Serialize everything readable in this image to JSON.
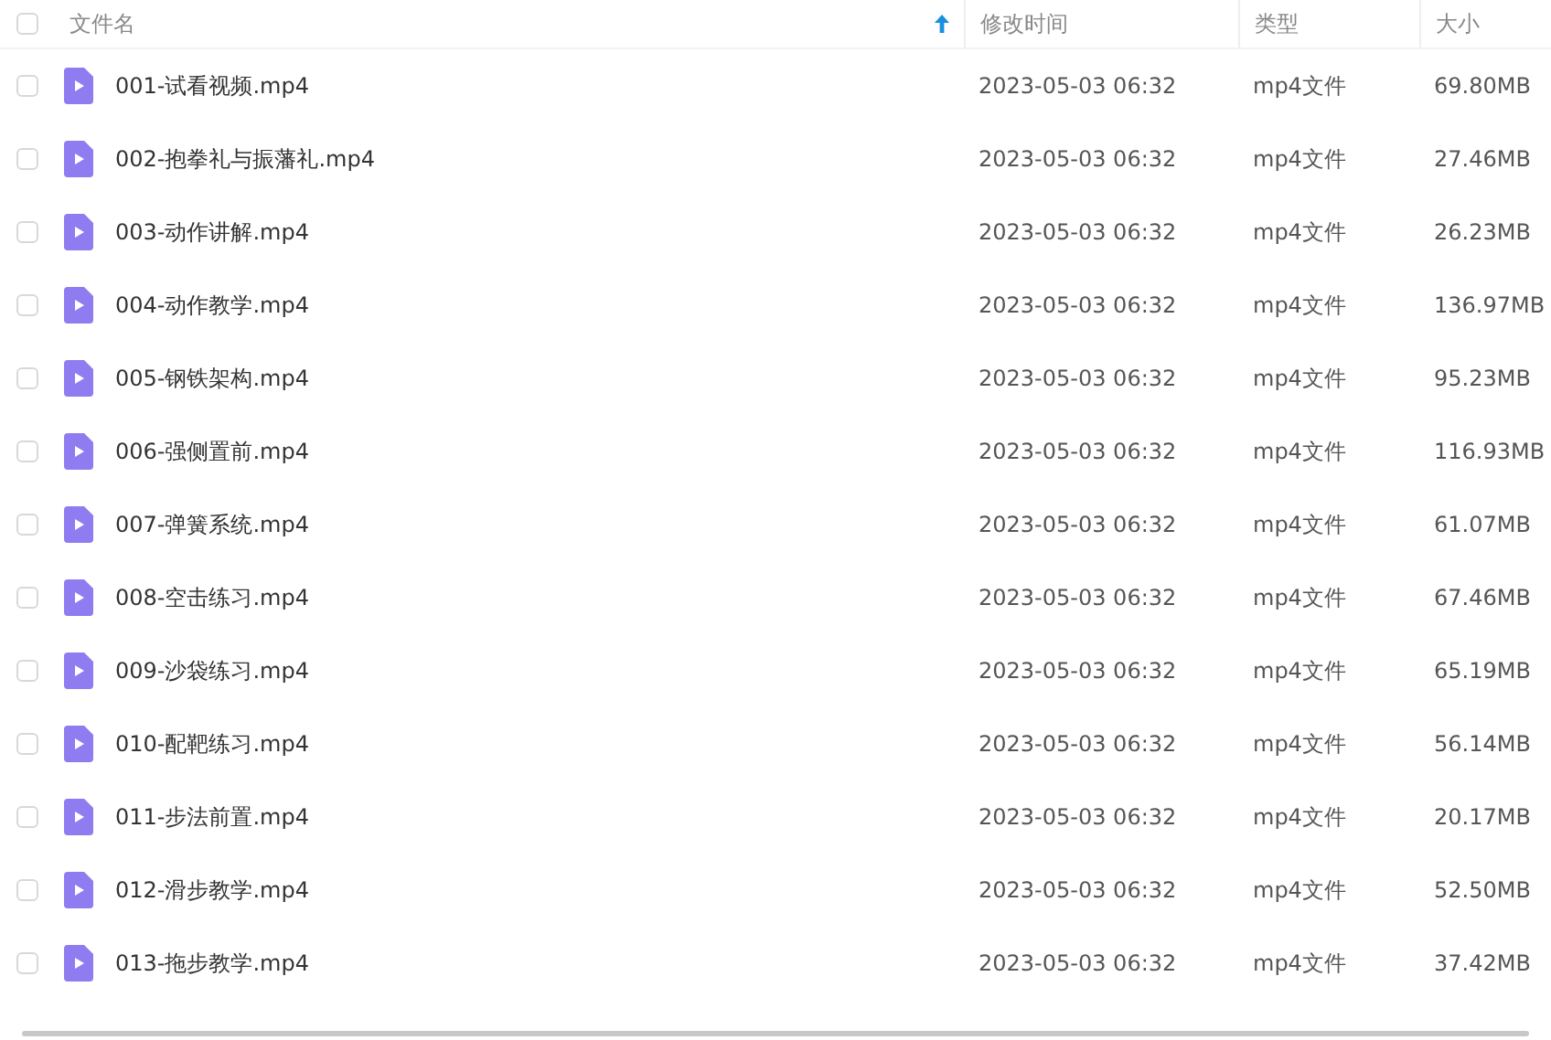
{
  "header": {
    "checked": false,
    "columns": [
      {
        "label": "文件名",
        "sorted": true
      },
      {
        "label": "修改时间",
        "sorted": false
      },
      {
        "label": "类型",
        "sorted": false
      },
      {
        "label": "大小",
        "sorted": false
      }
    ]
  },
  "rows": [
    {
      "name": "001-试看视频.mp4",
      "modified": "2023-05-03 06:32",
      "type": "mp4文件",
      "size": "69.80MB",
      "checked": false
    },
    {
      "name": "002-抱拳礼与振藩礼.mp4",
      "modified": "2023-05-03 06:32",
      "type": "mp4文件",
      "size": "27.46MB",
      "checked": false
    },
    {
      "name": "003-动作讲解.mp4",
      "modified": "2023-05-03 06:32",
      "type": "mp4文件",
      "size": "26.23MB",
      "checked": false
    },
    {
      "name": "004-动作教学.mp4",
      "modified": "2023-05-03 06:32",
      "type": "mp4文件",
      "size": "136.97MB",
      "checked": false
    },
    {
      "name": "005-钢铁架构.mp4",
      "modified": "2023-05-03 06:32",
      "type": "mp4文件",
      "size": "95.23MB",
      "checked": false
    },
    {
      "name": "006-强侧置前.mp4",
      "modified": "2023-05-03 06:32",
      "type": "mp4文件",
      "size": "116.93MB",
      "checked": false
    },
    {
      "name": "007-弹簧系统.mp4",
      "modified": "2023-05-03 06:32",
      "type": "mp4文件",
      "size": "61.07MB",
      "checked": false
    },
    {
      "name": "008-空击练习.mp4",
      "modified": "2023-05-03 06:32",
      "type": "mp4文件",
      "size": "67.46MB",
      "checked": false
    },
    {
      "name": "009-沙袋练习.mp4",
      "modified": "2023-05-03 06:32",
      "type": "mp4文件",
      "size": "65.19MB",
      "checked": false
    },
    {
      "name": "010-配靶练习.mp4",
      "modified": "2023-05-03 06:32",
      "type": "mp4文件",
      "size": "56.14MB",
      "checked": false
    },
    {
      "name": "011-步法前置.mp4",
      "modified": "2023-05-03 06:32",
      "type": "mp4文件",
      "size": "20.17MB",
      "checked": false
    },
    {
      "name": "012-滑步教学.mp4",
      "modified": "2023-05-03 06:32",
      "type": "mp4文件",
      "size": "52.50MB",
      "checked": false
    },
    {
      "name": "013-拖步教学.mp4",
      "modified": "2023-05-03 06:32",
      "type": "mp4文件",
      "size": "37.42MB",
      "checked": false
    }
  ]
}
